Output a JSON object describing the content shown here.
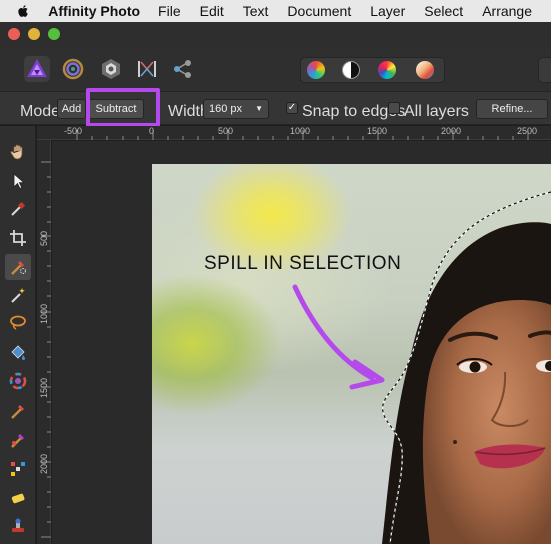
{
  "menubar": {
    "app_name": "Affinity Photo",
    "items": [
      "File",
      "Edit",
      "Text",
      "Document",
      "Layer",
      "Select",
      "Arrange"
    ]
  },
  "personas": [
    "photo-persona",
    "liquify-persona",
    "develop-persona",
    "tone-mapping-persona",
    "export-persona"
  ],
  "studio_buttons": [
    "color-wheel-icon",
    "black-white-icon",
    "hue-icon",
    "gradient-icon"
  ],
  "context_toolbar": {
    "mode_label": "Mode:",
    "add_label": "Add",
    "subtract_label": "Subtract",
    "width_label": "Width:",
    "width_value": "160 px",
    "snap_label": "Snap to edges",
    "snap_checked": true,
    "all_layers_label": "All layers",
    "all_layers_checked": false,
    "refine_label": "Refine..."
  },
  "ruler": {
    "top_labels": [
      "-500",
      "0",
      "500",
      "1000",
      "1500",
      "2000",
      "2500"
    ],
    "left_labels": [
      "500",
      "1000",
      "1500",
      "2000"
    ]
  },
  "tools": [
    "hand-tool",
    "move-tool",
    "color-picker-tool",
    "crop-tool",
    "selection-brush-tool",
    "flood-select-tool",
    "freehand-selection-tool",
    "flood-fill-tool",
    "gradient-tool",
    "paint-brush-tool",
    "color-replacement-tool",
    "pixel-tool",
    "erase-tool",
    "clone-tool"
  ],
  "annotation": {
    "text": "SPILL IN SELECTION",
    "color": "#b54aec"
  },
  "colors": {
    "highlight": "#b54aec",
    "arrow": "#b54aec"
  }
}
